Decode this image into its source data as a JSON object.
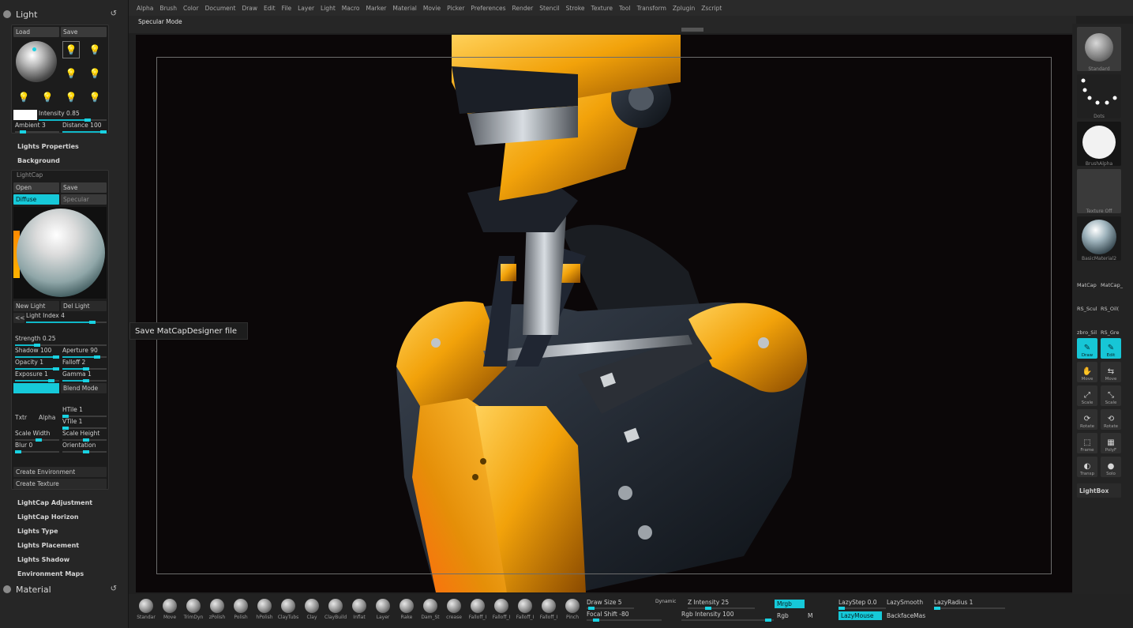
{
  "menu": [
    "Alpha",
    "Brush",
    "Color",
    "Document",
    "Draw",
    "Edit",
    "File",
    "Layer",
    "Light",
    "Macro",
    "Marker",
    "Material",
    "Movie",
    "Picker",
    "Preferences",
    "Render",
    "Stencil",
    "Stroke",
    "Texture",
    "Tool",
    "Transform",
    "Zplugin",
    "Zscript"
  ],
  "mode_label": "Specular Mode",
  "light_palette": {
    "title": "Light",
    "reset_icon": "↺",
    "load": "Load",
    "save": "Save",
    "intensity": "Intensity 0.85",
    "ambient": "Ambient 3",
    "distance": "Distance 100",
    "lights_properties": "Lights Properties",
    "background": "Background"
  },
  "lightcap": {
    "title": "LightCap",
    "open": "Open",
    "save": "Save",
    "diffuse": "Diffuse",
    "specular": "Specular",
    "new_light": "New Light",
    "del_light": "Del Light",
    "prev": "<<",
    "light_index": "Light Index 4",
    "strength": "Strength 0.25",
    "shadow": "Shadow 100",
    "aperture": "Aperture 90",
    "opacity": "Opacity 1",
    "falloff": "Falloff 2",
    "exposure": "Exposure 1",
    "gamma": "Gamma 1",
    "blend_mode": "Blend Mode",
    "txtr": "Txtr",
    "alpha": "Alpha",
    "htile": "HTile 1",
    "vtile": "VTile 1",
    "scale_width": "Scale Width",
    "scale_height": "Scale Height",
    "blur": "Blur 0",
    "orientation": "Orientation",
    "create_environment": "Create Environment",
    "create_texture": "Create Texture"
  },
  "left_menu": [
    "LightCap Adjustment",
    "LightCap Horizon",
    "Lights Type",
    "Lights Placement",
    "Lights Shadow",
    "Environment Maps"
  ],
  "material_palette": {
    "title": "Material",
    "reset_icon": "↺"
  },
  "tooltip": "Save MatCapDesigner file",
  "shelf": {
    "captions": [
      "Standard",
      "Dots",
      "BrushAlpha",
      "Texture Off",
      "BasicMaterial2"
    ],
    "matcap_row1": [
      "MatCap",
      "MatCap_"
    ],
    "matcap_row2": [
      "RS_Scul",
      "RS_Oil("
    ],
    "matcap_row3": [
      "zbro_Sil",
      "RS_Gre"
    ],
    "buttons": [
      {
        "label": "Draw",
        "icon": "✎",
        "active": true
      },
      {
        "label": "Edit",
        "icon": "✎",
        "active": true
      },
      {
        "label": "Move",
        "icon": "✋",
        "active": false
      },
      {
        "label": "Move",
        "icon": "⇆",
        "active": false
      },
      {
        "label": "Scale",
        "icon": "⤢",
        "active": false
      },
      {
        "label": "Scale",
        "icon": "⤡",
        "active": false
      },
      {
        "label": "Rotate",
        "icon": "⟳",
        "active": false
      },
      {
        "label": "Rotate",
        "icon": "⟲",
        "active": false
      },
      {
        "label": "Frame",
        "icon": "⬚",
        "active": false
      },
      {
        "label": "PolyF",
        "icon": "▦",
        "active": false
      },
      {
        "label": "Transp",
        "icon": "◐",
        "active": false
      },
      {
        "label": "Solo",
        "icon": "●",
        "active": false
      }
    ],
    "lightbox": "LightBox"
  },
  "brushes": [
    "Standar",
    "Move",
    "TrimDyn",
    "zPolish",
    "Polish",
    "hPolish",
    "ClayTubs",
    "Clay",
    "ClayBuild",
    "Inflat",
    "Layer",
    "Rake",
    "Dam_St",
    "crease",
    "Falloff_I",
    "Falloff_I",
    "Falloff_I",
    "Falloff_I",
    "Pinch"
  ],
  "bottom": {
    "draw_size": "Draw Size 5",
    "dynamic": "Dynamic",
    "focal_shift": "Focal Shift -80",
    "z_intensity": "Z Intensity 25",
    "rgb_intensity": "Rgb Intensity 100",
    "mrgb": "Mrgb",
    "rgb": "Rgb",
    "m": "M",
    "lazy_step": "LazyStep 0.0",
    "lazy_smooth": "LazySmooth",
    "lazy_radius": "LazyRadius 1",
    "lazy_mouse": "LazyMouse",
    "backface_mas": "BackfaceMas"
  },
  "colors": {
    "accent": "#16c9d9",
    "armor_gold": "#f2a20a",
    "armor_dark": "#1c2129"
  }
}
